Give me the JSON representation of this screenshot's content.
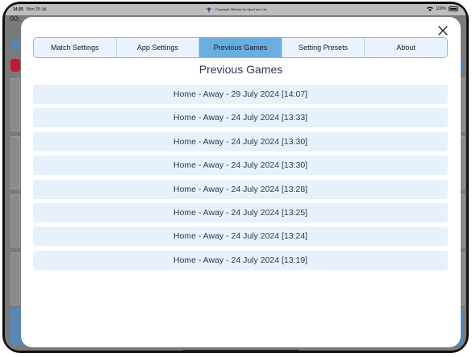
{
  "statusbar": {
    "time": "14:20",
    "date": "Mon 29 Jul",
    "copyright": "Copyright Officials for Sport and Ltd",
    "battery": "100%"
  },
  "background": {
    "top_left_text": "00:"
  },
  "tabs": [
    {
      "label": "Match Settings",
      "active": false
    },
    {
      "label": "App Settings",
      "active": false
    },
    {
      "label": "Previous Games",
      "active": true
    },
    {
      "label": "Setting Presets",
      "active": false
    },
    {
      "label": "About",
      "active": false
    }
  ],
  "page_title": "Previous Games",
  "games": [
    "Home - Away - 29 July 2024 [14:07]",
    "Home - Away - 24 July 2024 [13:33]",
    "Home - Away - 24 July 2024 [13:30]",
    "Home - Away - 24 July 2024 [13:30]",
    "Home - Away - 24 July 2024 [13:28]",
    "Home - Away - 24 July 2024 [13:25]",
    "Home - Away - 24 July 2024 [13:24]",
    "Home - Away - 24 July 2024 [13:19]"
  ],
  "colors": {
    "active_tab": "#6aaee0",
    "tab_bar": "#e9f3fd",
    "list_item": "#e6f1fb",
    "title": "#2b3a55"
  },
  "icons": {
    "close": "close-icon",
    "wifi": "wifi-icon",
    "battery": "battery-icon",
    "logo": "eagle-logo-icon"
  }
}
